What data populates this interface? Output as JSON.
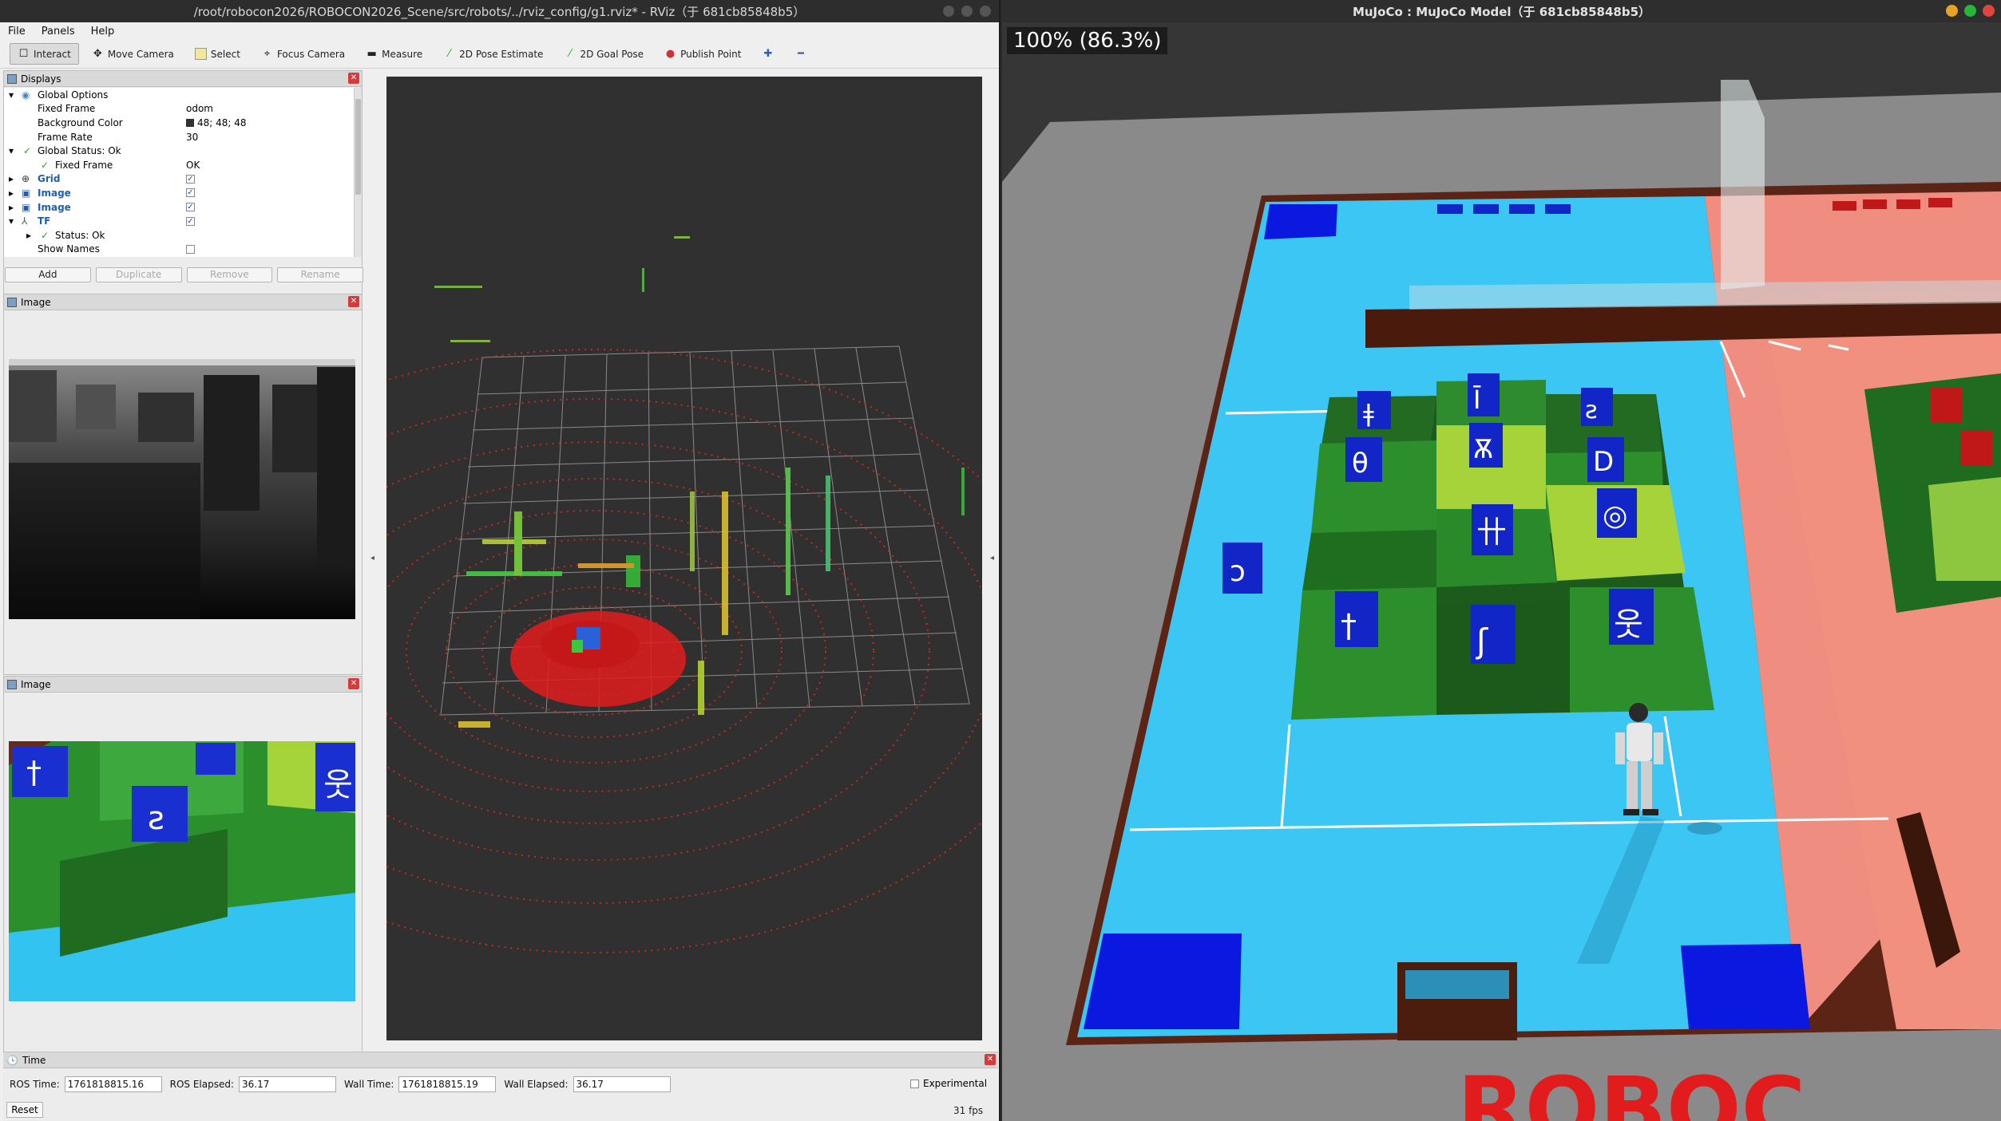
{
  "rviz": {
    "title": "/root/robocon2026/ROBOCON2026_Scene/src/robots/../rviz_config/g1.rviz* - RViz（于 681cb85848b5）",
    "menu": [
      "File",
      "Panels",
      "Help"
    ],
    "tools": [
      {
        "label": "Interact",
        "icon": "interact-icon"
      },
      {
        "label": "Move Camera",
        "icon": "move-camera-icon"
      },
      {
        "label": "Select",
        "icon": "select-icon"
      },
      {
        "label": "Focus Camera",
        "icon": "focus-camera-icon"
      },
      {
        "label": "Measure",
        "icon": "measure-icon"
      },
      {
        "label": "2D Pose Estimate",
        "icon": "pose-estimate-icon"
      },
      {
        "label": "2D Goal Pose",
        "icon": "goal-pose-icon"
      },
      {
        "label": "Publish Point",
        "icon": "publish-point-icon"
      }
    ],
    "displays": {
      "title": "Displays",
      "rows": {
        "global_options": "Global Options",
        "fixed_frame": "Fixed Frame",
        "fixed_frame_val": "odom",
        "bg_color": "Background Color",
        "bg_color_val": "48; 48; 48",
        "frame_rate": "Frame Rate",
        "frame_rate_val": "30",
        "global_status": "Global Status: Ok",
        "gs_fixed_frame": "Fixed Frame",
        "gs_fixed_frame_val": "OK",
        "grid": "Grid",
        "image1": "Image",
        "image2": "Image",
        "tf": "TF",
        "tf_status": "Status: Ok",
        "show_names": "Show Names"
      },
      "buttons": {
        "add": "Add",
        "duplicate": "Duplicate",
        "remove": "Remove",
        "rename": "Rename"
      }
    },
    "image_panel_1": {
      "title": "Image"
    },
    "image_panel_2": {
      "title": "Image"
    },
    "time": {
      "title": "Time",
      "ros_time_label": "ROS Time:",
      "ros_time": "1761818815.16",
      "ros_elapsed_label": "ROS Elapsed:",
      "ros_elapsed": "36.17",
      "wall_time_label": "Wall Time:",
      "wall_time": "1761818815.19",
      "wall_elapsed_label": "Wall Elapsed:",
      "wall_elapsed": "36.17",
      "experimental": "Experimental",
      "reset": "Reset",
      "fps": "31 fps"
    }
  },
  "mujoco": {
    "title": "MuJoCo : MuJoCo Model（于 681cb85848b5）",
    "overlay": "100% (86.3%)",
    "bottom_text": "ROBOC"
  },
  "colors": {
    "rviz_bg": "#303030",
    "field_blue": "#38c8f5",
    "field_red": "#f08a7a",
    "block_green": "#2e8b2e",
    "block_light": "#9ccf3a",
    "cube_blue": "#1226c8",
    "wall_brown": "#6b2a16"
  }
}
